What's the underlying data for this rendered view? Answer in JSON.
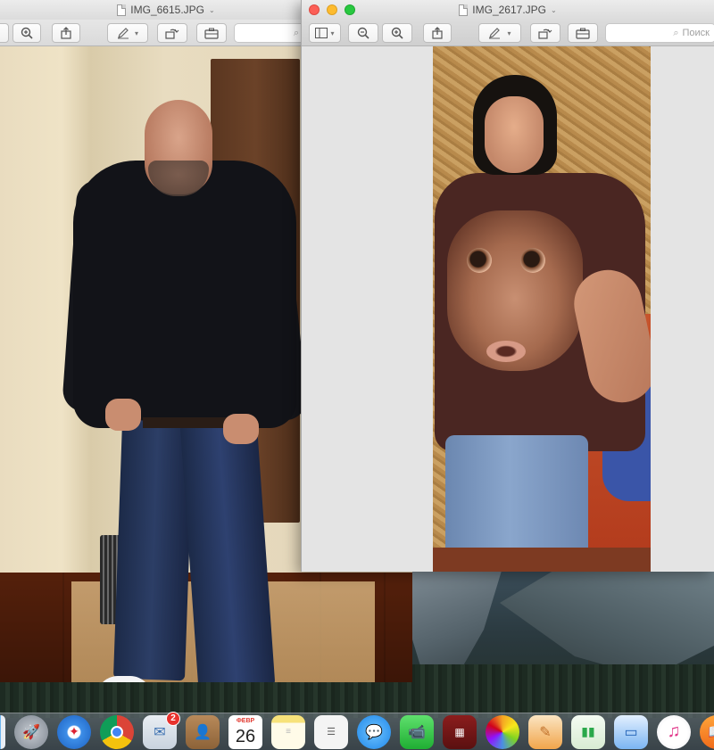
{
  "left_window": {
    "title": "IMG_6615.JPG"
  },
  "right_window": {
    "title": "IMG_2617.JPG",
    "search_placeholder": "Поиск"
  },
  "toolbar_icons": {
    "sidebar": "sidebar-icon",
    "zoom_out": "zoom-out-icon",
    "zoom_in": "zoom-in-icon",
    "share": "share-icon",
    "markup": "pen-icon",
    "rotate": "rotate-icon",
    "toolbox": "toolbox-icon"
  },
  "dock": {
    "items": [
      {
        "name": "Finder",
        "icon": "finder-icon"
      },
      {
        "name": "Launchpad",
        "icon": "rocket-icon"
      },
      {
        "name": "Safari",
        "icon": "compass-icon"
      },
      {
        "name": "Chrome",
        "icon": "chrome-icon"
      },
      {
        "name": "Mail",
        "icon": "mail-icon",
        "badge": "2"
      },
      {
        "name": "Contacts",
        "icon": "contacts-icon"
      },
      {
        "name": "Calendar",
        "icon": "calendar-icon",
        "month": "ФЕВР",
        "day": "26"
      },
      {
        "name": "Notes",
        "icon": "notes-icon"
      },
      {
        "name": "Reminders",
        "icon": "reminders-icon"
      },
      {
        "name": "Messages",
        "icon": "messages-icon"
      },
      {
        "name": "FaceTime",
        "icon": "facetime-icon"
      },
      {
        "name": "Photo Booth",
        "icon": "photobooth-icon"
      },
      {
        "name": "Photos",
        "icon": "photos-icon"
      },
      {
        "name": "Pages",
        "icon": "pages-icon"
      },
      {
        "name": "Numbers",
        "icon": "numbers-icon"
      },
      {
        "name": "Keynote",
        "icon": "keynote-icon"
      },
      {
        "name": "iTunes",
        "icon": "music-icon"
      },
      {
        "name": "iBooks",
        "icon": "books-icon"
      }
    ]
  },
  "colors": {
    "close": "#fc5f57",
    "minimize": "#fdbb2e",
    "maximize": "#28c840",
    "badge": "#e8322d"
  }
}
